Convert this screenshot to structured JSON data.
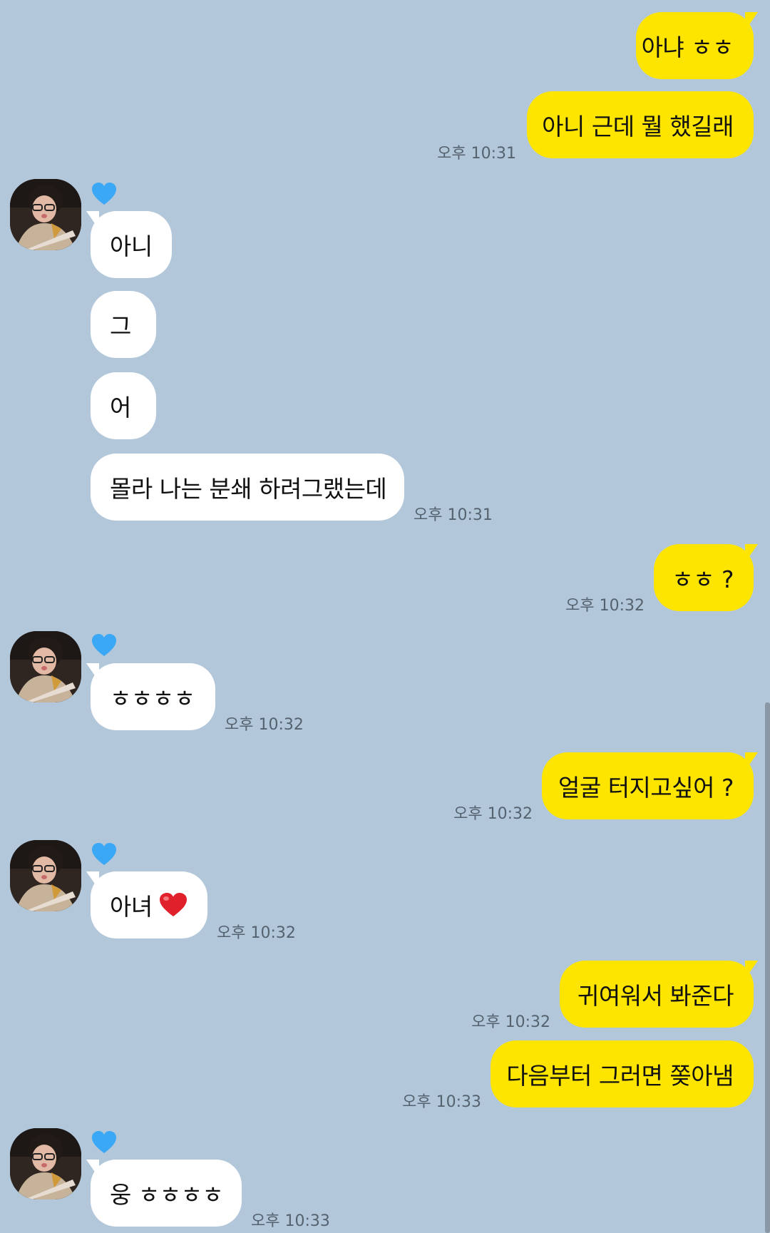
{
  "messages": [
    {
      "text": "아냐 ㅎㅎ",
      "time": ""
    },
    {
      "text": "아니 근데 뭘 했길래",
      "time": "오후 10:31"
    },
    {
      "text": "아니",
      "time": ""
    },
    {
      "text": "그",
      "time": ""
    },
    {
      "text": "어",
      "time": ""
    },
    {
      "text": "몰라 나는 분쇄 하려그랬는데",
      "time": "오후 10:31"
    },
    {
      "text": "ㅎㅎ ?",
      "time": "오후 10:32"
    },
    {
      "text": "ㅎㅎㅎㅎ",
      "time": "오후 10:32"
    },
    {
      "text": "얼굴 터지고싶어 ?",
      "time": "오후 10:32"
    },
    {
      "text": "아녀",
      "time": "오후 10:32"
    },
    {
      "text": "귀여워서 봐준다",
      "time": "오후 10:32"
    },
    {
      "text": "다음부터 그러면 쫒아냄",
      "time": "오후 10:33"
    },
    {
      "text": "웅 ㅎㅎㅎㅎ",
      "time": "오후 10:33"
    }
  ],
  "icons": {
    "sender_badge": "blue-heart-icon",
    "inline_emoji": "red-heart-icon",
    "avatar": "profile-photo"
  },
  "colors": {
    "background": "#b2c7d9",
    "outgoing_bubble": "#fee500",
    "incoming_bubble": "#ffffff",
    "timestamp": "#556270",
    "blue_heart": "#3aa8f5",
    "red_heart": "#e0202a"
  }
}
